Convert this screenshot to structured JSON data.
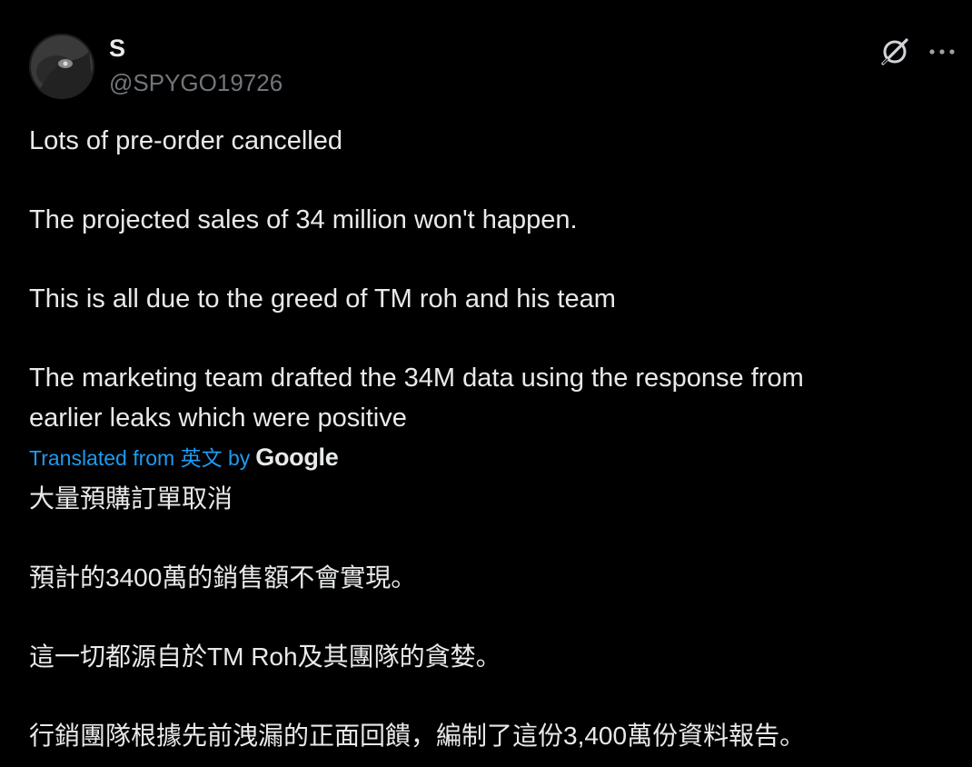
{
  "author": {
    "display_name": "S",
    "handle": "@SPYGO19726"
  },
  "icons": {
    "grok": "grok-icon",
    "more": "more-options-icon",
    "avatar": "profile-photo"
  },
  "tweet": {
    "paragraphs": [
      "Lots of pre-order cancelled",
      "The projected sales of 34 million won't happen.",
      "This is all due to the greed of TM roh and his team",
      "The marketing team drafted the 34M data using the response from",
      "earlier leaks which were positive"
    ]
  },
  "translation": {
    "label": "Translated from 英文 by",
    "provider": "Google",
    "paragraphs": [
      "大量預購訂單取消",
      "預計的3400萬的銷售額不會實現。",
      "這一切都源自於TM Roh及其團隊的貪婪。",
      "行銷團隊根據先前洩漏的正面回饋，編制了這份3,400萬份資料報告。"
    ]
  },
  "colors": {
    "background": "#000000",
    "text_primary": "#e7e9ea",
    "text_secondary": "#71767b",
    "link": "#1d9bf0"
  }
}
